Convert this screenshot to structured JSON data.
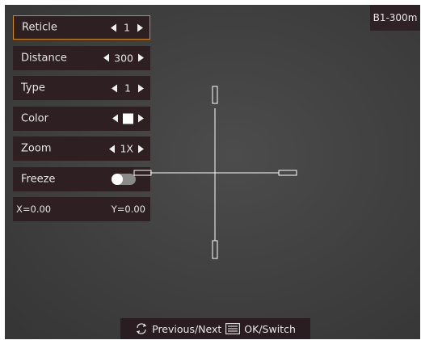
{
  "status": {
    "badge": "B1-300m"
  },
  "menu": {
    "reticle": {
      "label": "Reticle",
      "value": "1"
    },
    "distance": {
      "label": "Distance",
      "value": "300"
    },
    "type": {
      "label": "Type",
      "value": "1"
    },
    "color": {
      "label": "Color",
      "value_color": "#ffffff"
    },
    "zoom": {
      "label": "Zoom",
      "value": "1X"
    },
    "freeze": {
      "label": "Freeze",
      "state": "off"
    },
    "coords": {
      "x": "X=0.00",
      "y": "Y=0.00"
    }
  },
  "footer": {
    "prev_next_label": "Previous/Next",
    "ok_switch_label": "OK/Switch",
    "prev_next_icon": "cycle-arrows-icon",
    "ok_switch_icon": "menu-list-icon"
  },
  "colors": {
    "panel_bg": "#2e1f23",
    "selected_border": "#d8861e",
    "reticle": "#ffffff"
  }
}
